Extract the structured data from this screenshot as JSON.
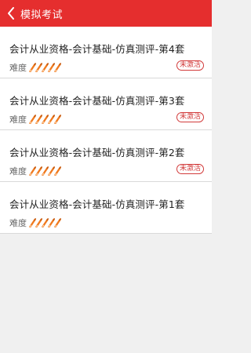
{
  "header": {
    "title": "模拟考试",
    "back_icon": "chevron-left-icon",
    "bg_color": "#e52e2e"
  },
  "difficulty_label": "难度",
  "exams": [
    {
      "title": "会计从业资格-会计基础-仿真测评-第4套",
      "difficulty": 5,
      "status": "未激活"
    },
    {
      "title": "会计从业资格-会计基础-仿真测评-第3套",
      "difficulty": 5,
      "status": "未激活"
    },
    {
      "title": "会计从业资格-会计基础-仿真测评-第2套",
      "difficulty": 5,
      "status": "未激活"
    },
    {
      "title": "会计从业资格-会计基础-仿真测评-第1套",
      "difficulty": 5,
      "status": ""
    }
  ],
  "colors": {
    "accent": "#e52e2e",
    "badge": "#d23b3b",
    "pencil": "#f07a1f"
  }
}
